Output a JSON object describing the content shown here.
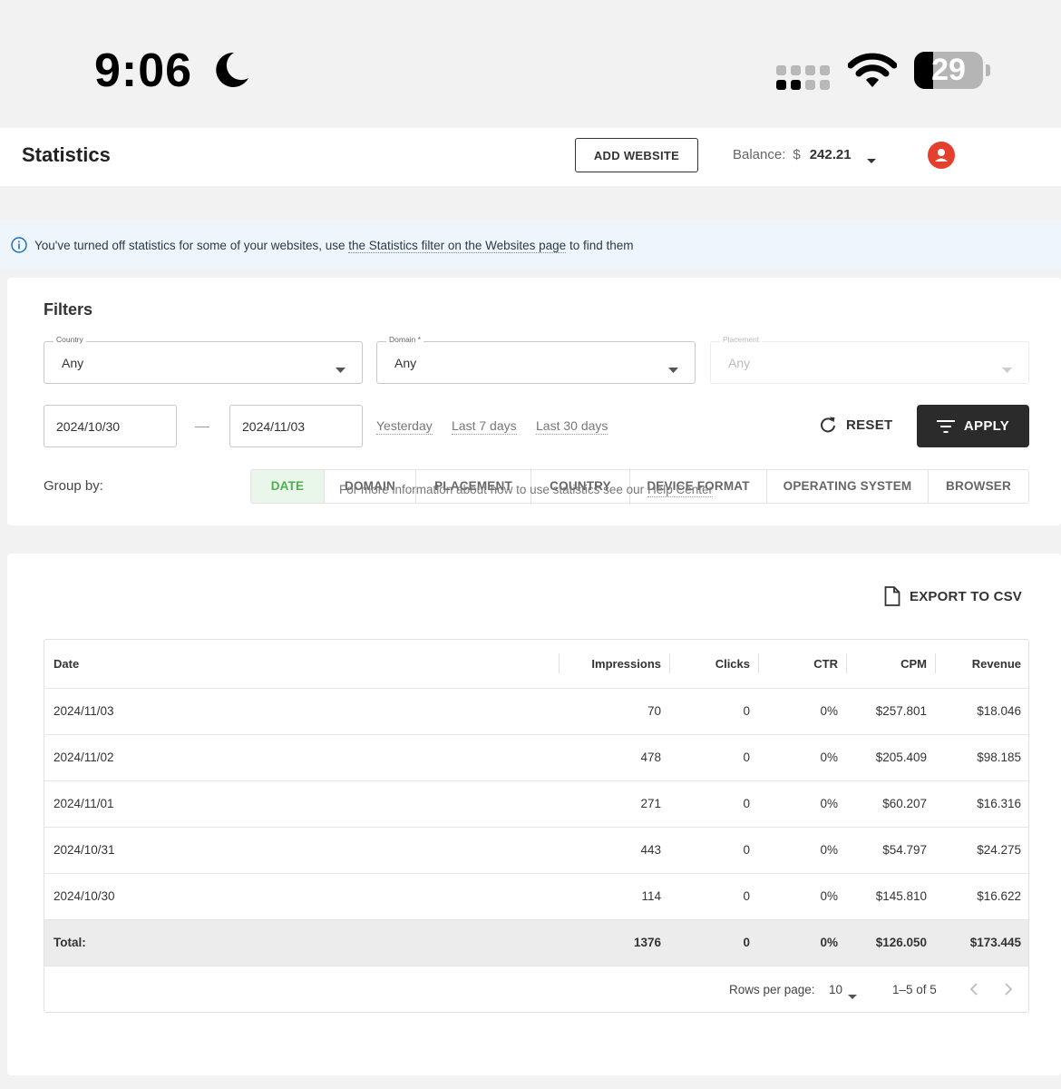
{
  "status_bar": {
    "time": "9:06",
    "battery": "29",
    "icons": [
      "moon-icon",
      "signal-icon",
      "wifi-icon",
      "battery-icon"
    ]
  },
  "header": {
    "title": "Statistics",
    "add_website": "ADD WEBSITE",
    "balance_label": "Balance:",
    "currency": "$",
    "balance_value": "242.21"
  },
  "notice": {
    "text_before": "You've turned off statistics for some of your websites, use",
    "link_text": "the Statistics filter on the Websites page",
    "text_after": "to find them"
  },
  "filters": {
    "title": "Filters",
    "country": {
      "label": "Country",
      "value": "Any"
    },
    "domain": {
      "label": "Domain *",
      "value": "Any"
    },
    "placement": {
      "label": "Placement",
      "value": "Any"
    },
    "date_from": "2024/10/30",
    "date_to": "2024/11/03",
    "quick_ranges": [
      "Yesterday",
      "Last 7 days",
      "Last 30 days"
    ],
    "reset": "RESET",
    "apply": "APPLY",
    "group_by_label": "Group by:",
    "group_tabs": [
      "DATE",
      "DOMAIN",
      "PLACEMENT",
      "COUNTRY",
      "DEVICE FORMAT",
      "OPERATING SYSTEM",
      "BROWSER"
    ],
    "active_group": "DATE"
  },
  "results": {
    "export": "EXPORT TO CSV",
    "columns": [
      "Date",
      "Impressions",
      "Clicks",
      "CTR",
      "CPM",
      "Revenue"
    ],
    "rows": [
      [
        "2024/11/03",
        "70",
        "0",
        "0%",
        "$257.801",
        "$18.046"
      ],
      [
        "2024/11/02",
        "478",
        "0",
        "0%",
        "$205.409",
        "$98.185"
      ],
      [
        "2024/11/01",
        "271",
        "0",
        "0%",
        "$60.207",
        "$16.316"
      ],
      [
        "2024/10/31",
        "443",
        "0",
        "0%",
        "$54.797",
        "$24.275"
      ],
      [
        "2024/10/30",
        "114",
        "0",
        "0%",
        "$145.810",
        "$16.622"
      ]
    ],
    "total": [
      "Total:",
      "1376",
      "0",
      "0%",
      "$126.050",
      "$173.445"
    ],
    "rows_per_page_label": "Rows per page:",
    "rows_per_page": "10",
    "range": "1–5 of 5"
  },
  "footer": {
    "text": "For more information about how to use statistics see our",
    "link": "Help Center"
  },
  "colors": {
    "accent_green": "#4caf50",
    "avatar_red": "#e5402d",
    "apply_bg": "#2b2b2b",
    "notice_bg": "#eef6fb"
  }
}
